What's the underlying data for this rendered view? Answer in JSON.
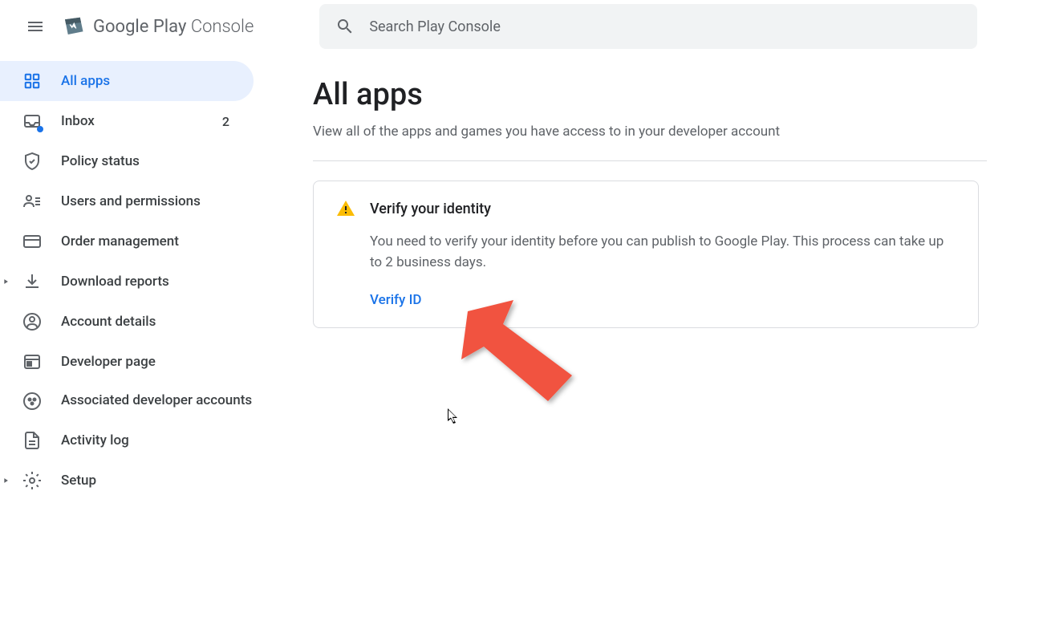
{
  "header": {
    "logo_text_main": "Google Play ",
    "logo_text_sub": "Console"
  },
  "search": {
    "placeholder": "Search Play Console"
  },
  "sidebar": {
    "all_apps": "All apps",
    "inbox": "Inbox",
    "inbox_count": "2",
    "policy_status": "Policy status",
    "users_permissions": "Users and permissions",
    "order_management": "Order management",
    "download_reports": "Download reports",
    "account_details": "Account details",
    "developer_page": "Developer page",
    "associated_accounts": "Associated developer accounts",
    "activity_log": "Activity log",
    "setup": "Setup"
  },
  "main": {
    "title": "All apps",
    "subtitle": "View all of the apps and games you have access to in your developer account"
  },
  "alert": {
    "title": "Verify your identity",
    "body": "You need to verify your identity before you can publish to Google Play. This process can take up to 2 business days.",
    "action": "Verify ID"
  }
}
